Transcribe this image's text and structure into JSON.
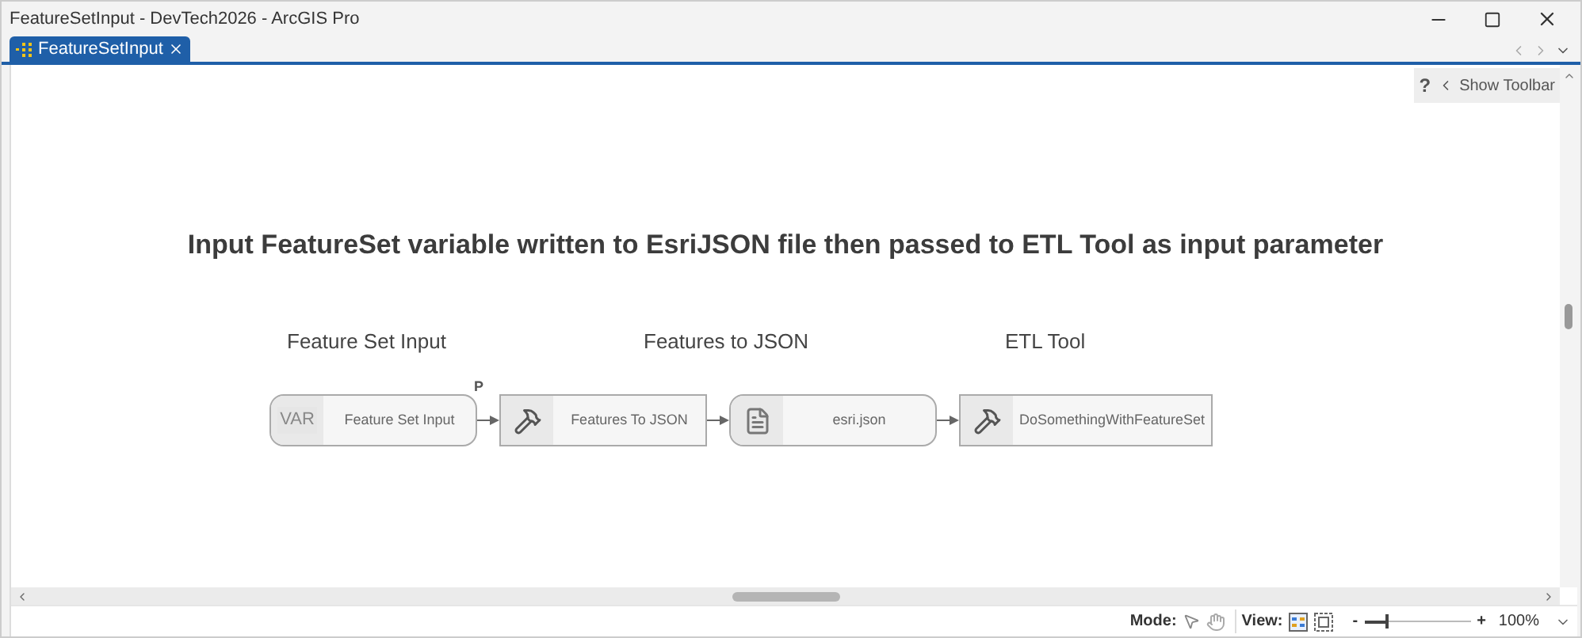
{
  "window": {
    "title": "FeatureSetInput - DevTech2026 - ArcGIS Pro"
  },
  "tabs": [
    {
      "label": "FeatureSetInput",
      "selected": true
    }
  ],
  "toolbar_toggle": {
    "help": "?",
    "label": "Show Toolbar"
  },
  "canvas": {
    "heading": "Input FeatureSet variable written to EsriJSON file then passed to ETL Tool as input parameter",
    "column_labels": [
      "Feature Set Input",
      "Features to JSON",
      "ETL Tool"
    ],
    "nodes": [
      {
        "kind": "variable",
        "badge": "VAR",
        "label": "Feature Set Input",
        "tag": "P"
      },
      {
        "kind": "tool",
        "label": "Features To JSON"
      },
      {
        "kind": "data",
        "label": "esri.json"
      },
      {
        "kind": "tool",
        "label": "DoSomethingWithFeatureSet"
      }
    ]
  },
  "status_bar": {
    "mode_label": "Mode:",
    "view_label": "View:",
    "zoom_out": "-",
    "zoom_in": "+",
    "zoom": {
      "level": 0.22
    },
    "zoom_text": "100%"
  }
}
